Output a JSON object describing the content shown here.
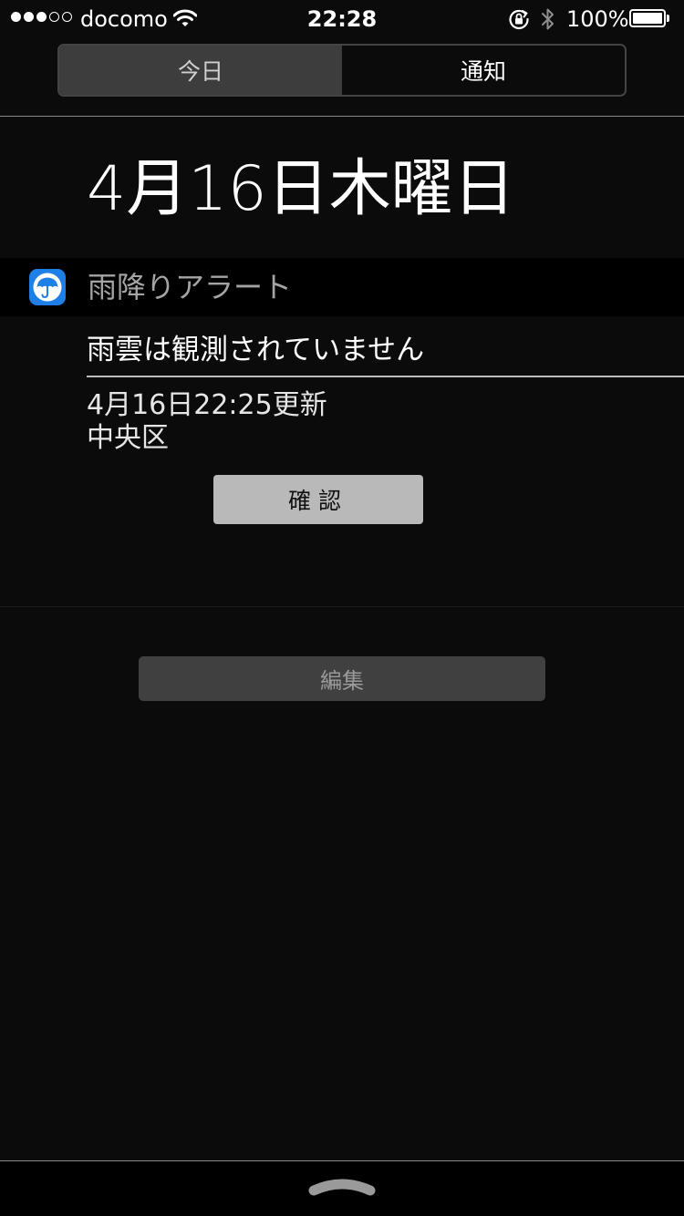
{
  "status_bar": {
    "carrier": "docomo",
    "time": "22:28",
    "battery_percent": "100%",
    "battery_level": 1.0,
    "signal_bars_filled": 3,
    "signal_bars_total": 5,
    "icons": [
      "wifi-icon",
      "rotation-lock-icon",
      "bluetooth-icon",
      "battery-icon"
    ]
  },
  "tabs": {
    "today": "今日",
    "notifications": "通知",
    "selected": "today"
  },
  "date_heading": "4月16日木曜日",
  "widget": {
    "app_name": "雨降りアラート",
    "app_icon": "umbrella-app-icon",
    "app_icon_color": "#1e7fe6",
    "message": "雨雲は観測されていません",
    "updated": "4月16日22:25更新",
    "area": "中央区",
    "confirm_label": "確認"
  },
  "edit_label": "編集",
  "bottom": {
    "grabber_icon": "chevron-up-icon"
  }
}
